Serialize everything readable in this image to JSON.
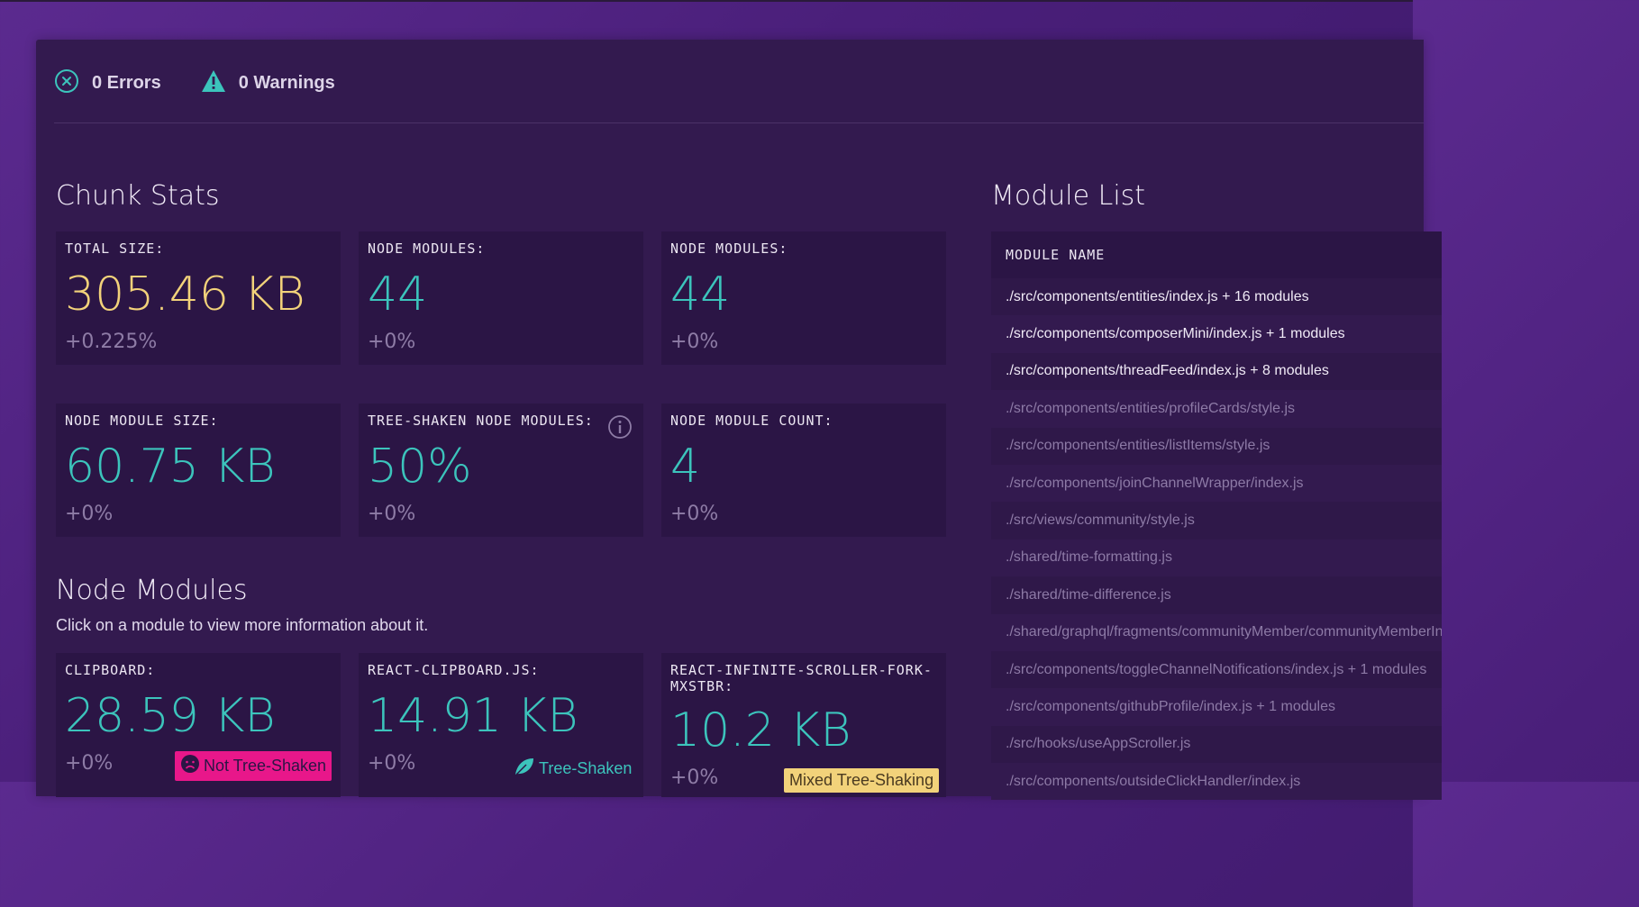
{
  "status": {
    "errors": "0 Errors",
    "warnings": "0 Warnings"
  },
  "chunk_stats": {
    "title": "Chunk Stats",
    "cards": [
      {
        "label": "TOTAL SIZE:",
        "value": "305.46 KB",
        "delta": "+0.225%"
      },
      {
        "label": "NODE MODULES:",
        "value": "44",
        "delta": "+0%"
      },
      {
        "label": "NODE MODULES:",
        "value": "44",
        "delta": "+0%"
      },
      {
        "label": "NODE MODULE SIZE:",
        "value": "60.75 KB",
        "delta": "+0%"
      },
      {
        "label": "TREE-SHAKEN NODE MODULES:",
        "value": "50%",
        "delta": "+0%"
      },
      {
        "label": "NODE MODULE COUNT:",
        "value": "4",
        "delta": "+0%"
      }
    ]
  },
  "node_modules": {
    "title": "Node Modules",
    "subtitle": "Click on a module to view more information about it.",
    "cards": [
      {
        "label": "CLIPBOARD:",
        "value": "28.59 KB",
        "delta": "+0%",
        "badge": "Not Tree-Shaken"
      },
      {
        "label": "REACT-CLIPBOARD.JS:",
        "value": "14.91 KB",
        "delta": "+0%",
        "badge": "Tree-Shaken"
      },
      {
        "label": "REACT-INFINITE-SCROLLER-FORK-MXSTBR:",
        "value": "10.2 KB",
        "delta": "+0%",
        "badge": "Mixed Tree-Shaking"
      }
    ]
  },
  "module_list": {
    "title": "Module List",
    "header": "MODULE NAME",
    "rows": [
      {
        "name": "./src/components/entities/index.js + 16 modules",
        "bright": true
      },
      {
        "name": "./src/components/composerMini/index.js + 1 modules",
        "bright": true
      },
      {
        "name": "./src/components/threadFeed/index.js + 8 modules",
        "bright": true
      },
      {
        "name": "./src/components/entities/profileCards/style.js",
        "bright": false
      },
      {
        "name": "./src/components/entities/listItems/style.js",
        "bright": false
      },
      {
        "name": "./src/components/joinChannelWrapper/index.js",
        "bright": false
      },
      {
        "name": "./src/views/community/style.js",
        "bright": false
      },
      {
        "name": "./shared/time-formatting.js",
        "bright": false
      },
      {
        "name": "./shared/time-difference.js",
        "bright": false
      },
      {
        "name": "./shared/graphql/fragments/communityMember/communityMemberInfo.js",
        "bright": false
      },
      {
        "name": "./src/components/toggleChannelNotifications/index.js + 1 modules",
        "bright": false
      },
      {
        "name": "./src/components/githubProfile/index.js + 1 modules",
        "bright": false
      },
      {
        "name": "./src/hooks/useAppScroller.js",
        "bright": false
      },
      {
        "name": "./src/components/outsideClickHandler/index.js",
        "bright": false
      }
    ]
  },
  "colors": {
    "accent_teal": "#3cc4bc",
    "accent_yellow": "#f2d27a",
    "accent_pink": "#e8178a"
  }
}
